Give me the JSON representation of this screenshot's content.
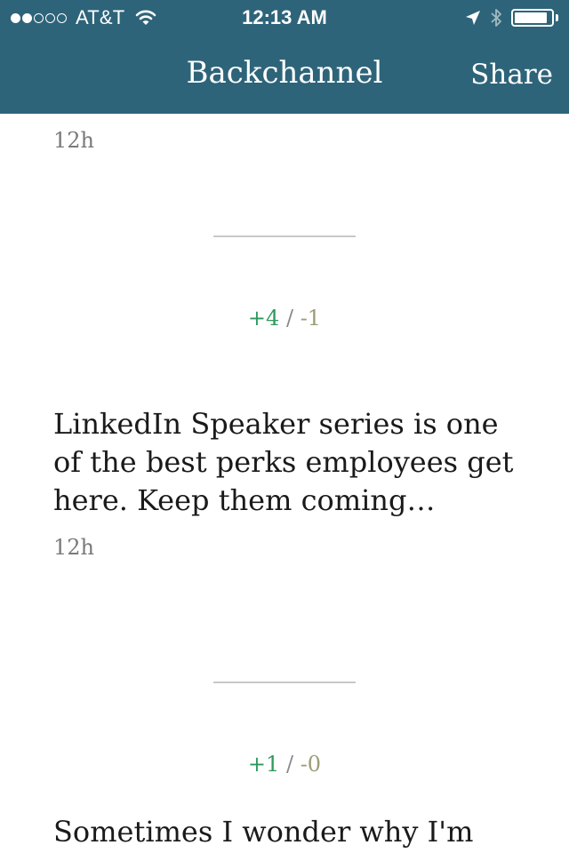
{
  "status_bar": {
    "carrier": "AT&T",
    "time": "12:13 AM",
    "signal_bars_filled": 2,
    "signal_bars_total": 5,
    "battery_level": 0.9,
    "icons": [
      "wifi-icon",
      "location-arrow-icon",
      "bluetooth-icon",
      "battery-icon"
    ]
  },
  "nav": {
    "title": "Backchannel",
    "share_label": "Share"
  },
  "colors": {
    "header_bg": "#2e6479",
    "upvote": "#2e9a5c",
    "downvote": "#9c9c78"
  },
  "feed": [
    {
      "time": "12h",
      "votes_up": "+4",
      "separator": "/",
      "votes_down": "-1"
    },
    {
      "text": "LinkedIn Speaker series is one of the best perks employees get here. Keep them coming…",
      "time": "12h",
      "votes_up": "+1",
      "separator": "/",
      "votes_down": "-0"
    },
    {
      "text": "Sometimes I wonder why I'm"
    }
  ]
}
